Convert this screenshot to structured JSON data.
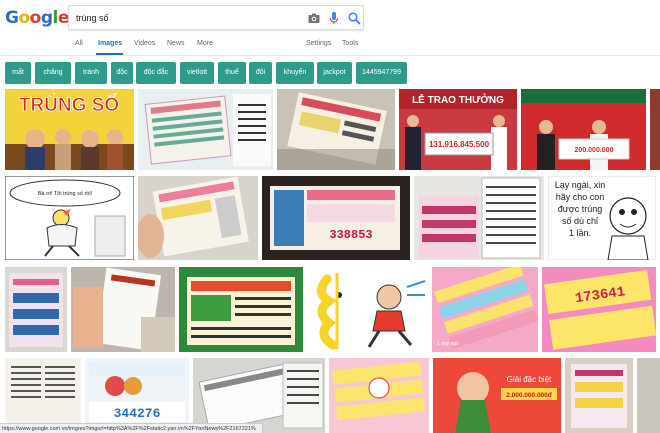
{
  "header": {
    "logo_letters": [
      "G",
      "o",
      "o",
      "g",
      "l",
      "e"
    ],
    "search_value": "trúng số",
    "icons": [
      "camera-icon",
      "microphone-icon",
      "search-icon"
    ]
  },
  "nav": {
    "tabs": [
      "All",
      "Images",
      "Videos",
      "News",
      "More"
    ],
    "active_tab": "Images",
    "right": [
      "Settings",
      "Tools"
    ]
  },
  "chips": [
    "mất",
    "chăng",
    "tránh",
    "độc",
    "độc đắc",
    "vietlott",
    "thuế",
    "đôi",
    "khuyến",
    "jackpot",
    "1445947799"
  ],
  "images": {
    "r1c1_text": "TRÚNG SỐ",
    "r1c4_text": "LỄ TRAO THƯỞNG",
    "r1c4_amount": "131.916.845.500",
    "r1c5_amount": "200.000.000",
    "r2c1_bubble": "Bà ơi! Tôi trúng số rồi!",
    "r2c3_number": "338853",
    "r2c5_text_lines": [
      "Lạy ngài, xin",
      "hãy cho con",
      "được trúng",
      "số dù chỉ",
      "1 lần."
    ],
    "r3c6_number": "173641",
    "r4c3_number": "344276",
    "r4c6_label": "Giải đặc biệt",
    "r4c6_amount": "2.000.000.000đ",
    "day_ago": "1 day ago"
  },
  "status": {
    "url": "https://www.google.com.vn/imgres?imgurl=http%3A%2F%2Fstatic2.yan.vn%2FYanNews%2F2167221%"
  },
  "colors": {
    "chip": "#2f9b8a",
    "accent": "#2a6ebb"
  }
}
